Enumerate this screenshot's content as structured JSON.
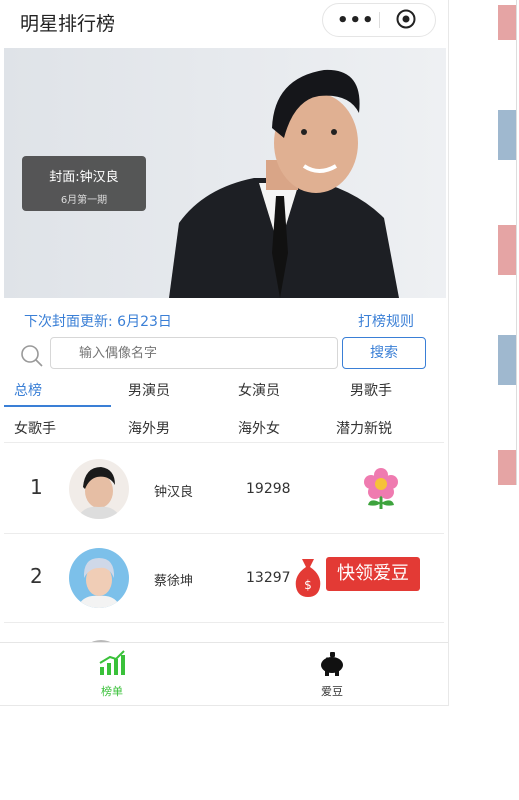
{
  "app": {
    "title": "明星排行榜"
  },
  "banner": {
    "cover_label": "封面:钟汉良",
    "cover_sub": "6月第一期"
  },
  "update": {
    "next_update": "下次封面更新: 6月23日",
    "rules_link": "打榜规则"
  },
  "search": {
    "placeholder": "输入偶像名字",
    "button": "搜索"
  },
  "categories": [
    "总榜",
    "男演员",
    "女演员",
    "男歌手",
    "女歌手",
    "海外男",
    "海外女",
    "潜力新锐"
  ],
  "active_category": "总榜",
  "rankings": [
    {
      "rank": "1",
      "name": "钟汉良",
      "votes": "19298"
    },
    {
      "rank": "2",
      "name": "蔡徐坤",
      "votes": "13297"
    }
  ],
  "promo": {
    "label": "快领爱豆"
  },
  "tabbar": {
    "items": [
      {
        "label": "榜单",
        "icon": "chart-bars-icon"
      },
      {
        "label": "爱豆",
        "icon": "piggy-bank-icon"
      }
    ]
  },
  "colors": {
    "accent": "#3a7fd6",
    "promo": "#e33a35",
    "tab_active": "#3ac13a"
  }
}
